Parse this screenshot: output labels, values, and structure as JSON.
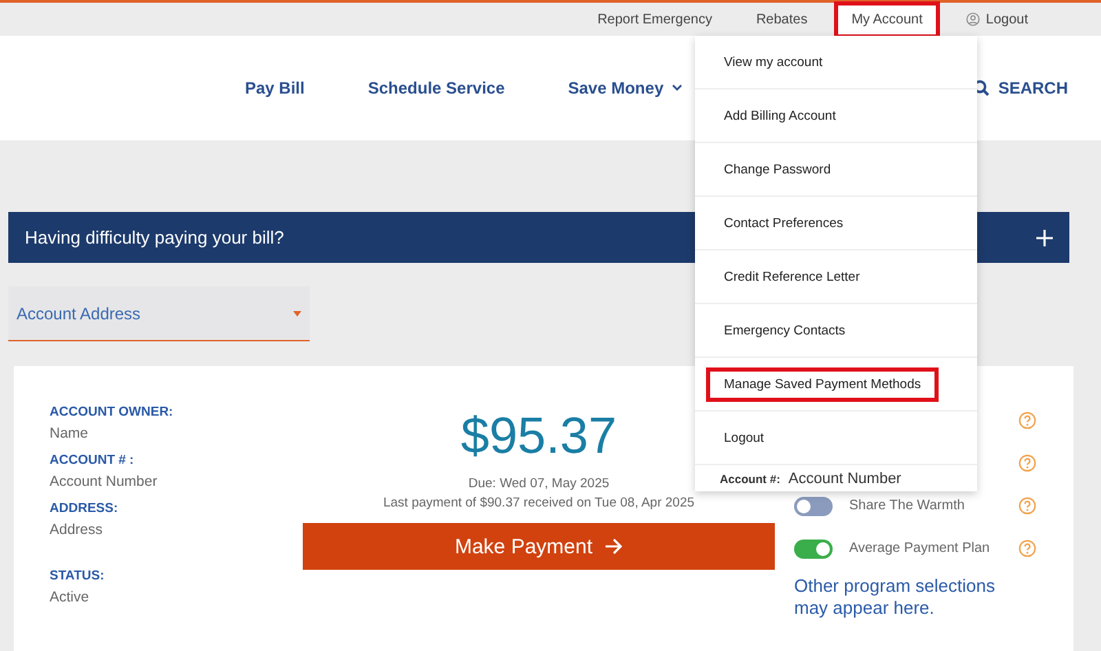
{
  "utility_nav": [
    {
      "label": "Report Emergency",
      "highlighted": false,
      "kind": "link"
    },
    {
      "label": "Rebates",
      "highlighted": false,
      "kind": "link"
    },
    {
      "label": "My Account",
      "highlighted": true,
      "kind": "link"
    },
    {
      "label": "Logout",
      "highlighted": false,
      "kind": "logout"
    }
  ],
  "main_nav": [
    {
      "label": "Pay Bill",
      "kind": "link"
    },
    {
      "label": "Schedule Service",
      "kind": "link"
    },
    {
      "label": "Save Money",
      "kind": "menu"
    }
  ],
  "search": {
    "label": "SEARCH"
  },
  "account_menu": {
    "items": [
      {
        "label": "View my account",
        "highlighted": false
      },
      {
        "label": "Add Billing Account",
        "highlighted": false
      },
      {
        "label": "Change Password",
        "highlighted": false
      },
      {
        "label": "Contact Preferences",
        "highlighted": false
      },
      {
        "label": "Credit Reference Letter",
        "highlighted": false
      },
      {
        "label": "Emergency Contacts",
        "highlighted": false
      },
      {
        "label": "Manage Saved Payment Methods",
        "highlighted": true
      },
      {
        "label": "Logout",
        "highlighted": false
      }
    ],
    "footer_label": "Account #:",
    "footer_value": "Account Number"
  },
  "banner": {
    "title": "Having difficulty paying your bill?"
  },
  "account_select": {
    "value": "Account Address"
  },
  "account_details": [
    {
      "label": "ACCOUNT OWNER:",
      "value": "Name"
    },
    {
      "label": "ACCOUNT # :",
      "value": "Account Number"
    },
    {
      "label": "ADDRESS:",
      "value": "Address"
    },
    {
      "label": "STATUS:",
      "value": "Active"
    }
  ],
  "balance": {
    "amount": "$95.37",
    "due": "Due: Wed 07, May 2025",
    "last_payment": "Last payment of $90.37 received on Tue 08, Apr 2025",
    "button": "Make Payment"
  },
  "programs": [
    {
      "kind": "covered"
    },
    {
      "kind": "covered"
    },
    {
      "kind": "toggle",
      "label": "Share The Warmth",
      "on": false
    },
    {
      "kind": "toggle",
      "label": "Average Payment Plan",
      "on": true
    }
  ],
  "programs_note": "Other program selections may appear here."
}
